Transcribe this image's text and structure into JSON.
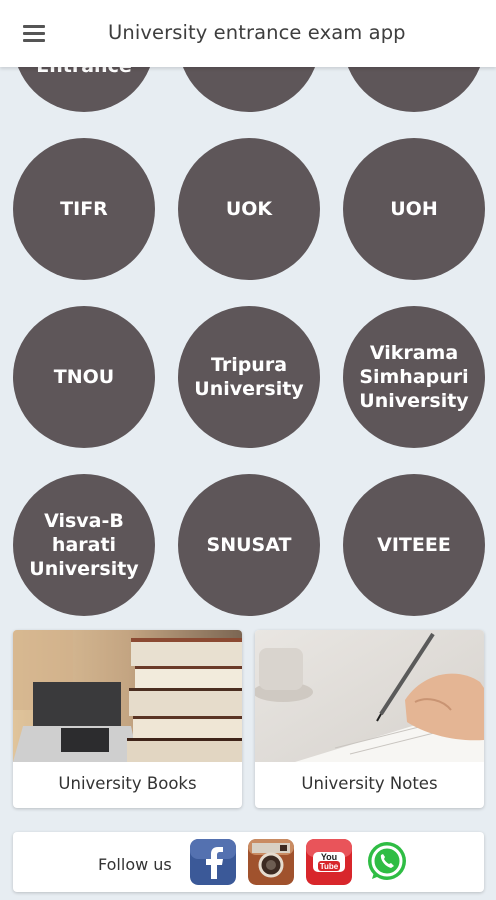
{
  "appbar": {
    "title": "University entrance exam app",
    "menu_icon": "hamburger-menu-icon"
  },
  "grid": {
    "partial_row": [
      "Entrance",
      "",
      ""
    ],
    "rows": [
      [
        "TIFR",
        "UOK",
        "UOH"
      ],
      [
        "TNOU",
        "Tripura\nUniversity",
        "Vikrama\nSimhapuri\nUniversity"
      ],
      [
        "Visva-B\nharati\nUniversity",
        "SNUSAT",
        "VITEEE"
      ]
    ],
    "circle_color": "#5e5659"
  },
  "cards": {
    "books_label": "University Books",
    "notes_label": "University Notes"
  },
  "follow": {
    "label": "Follow us",
    "icons": [
      "facebook-icon",
      "instagram-icon",
      "youtube-icon",
      "whatsapp-icon"
    ],
    "youtube_text": "You Tube"
  },
  "colors": {
    "facebook": "#3b5998",
    "instagram": "#a0522d",
    "youtube": "#d8262b",
    "whatsapp": "#2fbd44"
  }
}
